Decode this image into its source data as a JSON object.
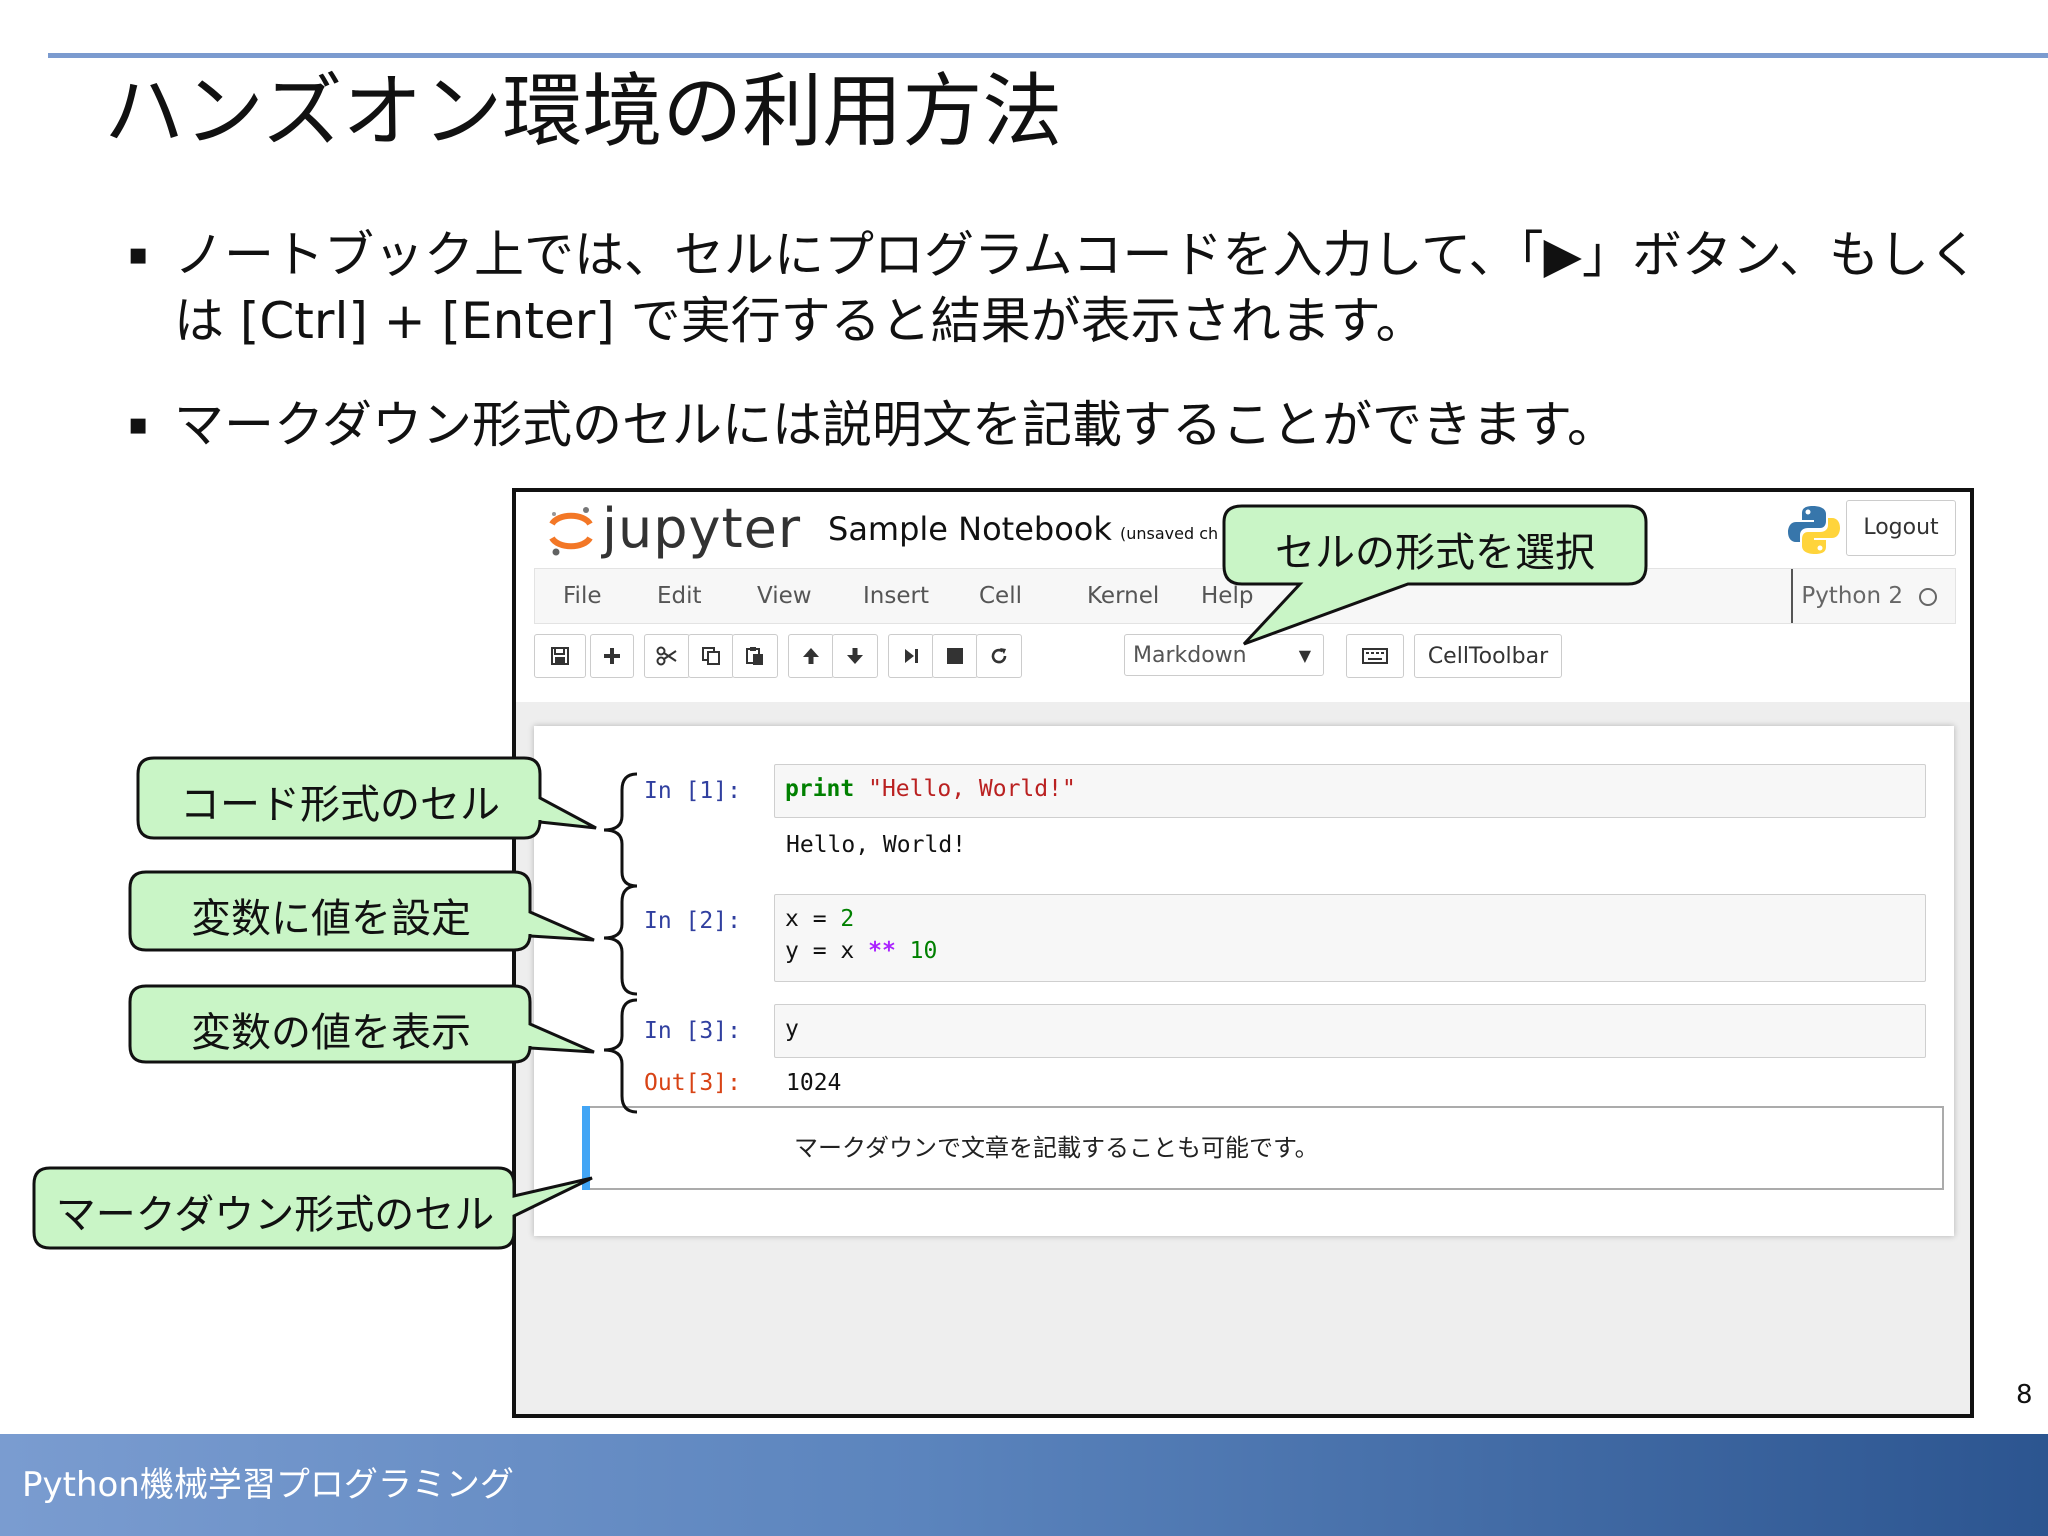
{
  "slide": {
    "title": "ハンズオン環境の利用方法",
    "bullets": [
      "ノートブック上では、セルにプログラムコードを入力して、「▶」ボタン、もしくは [Ctrl] + [Enter] で実行すると結果が表示されます。",
      "マークダウン形式のセルには説明文を記載することができます。"
    ],
    "bullet_mark": "▪",
    "page_number": "8",
    "footer": "Python機械学習プログラミング"
  },
  "jupyter": {
    "logo_text": "jupyter",
    "notebook_name": "Sample Notebook",
    "unsaved": "(unsaved ch",
    "logout": "Logout",
    "menu": [
      "File",
      "Edit",
      "View",
      "Insert",
      "Cell",
      "Kernel",
      "Help"
    ],
    "kernel": "Python 2",
    "cell_type_select": "Markdown",
    "celltoolbar": "CellToolbar",
    "cells": {
      "c1": {
        "prompt": "In [1]:",
        "output": "Hello, World!"
      },
      "c2": {
        "prompt": "In [2]:"
      },
      "c3": {
        "prompt": "In [3]:",
        "code": "y",
        "out_prompt": "Out[3]:",
        "output": "1024"
      },
      "md": {
        "text": "マークダウンで文章を記載することも可能です。"
      }
    },
    "code_tokens": {
      "print_kw": "print",
      "hello_str": "\"Hello, World!\"",
      "x_assign": "x = ",
      "two": "2",
      "y_assign": "y = x ",
      "pow_op": "**",
      "ten": "10"
    }
  },
  "callouts": {
    "cell_format": "セルの形式を選択",
    "code_cell": "コード形式のセル",
    "set_var": "変数に値を設定",
    "show_var": "変数の値を表示",
    "markdown_cell": "マークダウン形式のセル"
  },
  "colors": {
    "callout_fill": "#c9f5c6",
    "footer_start": "#7a9cd0",
    "footer_end": "#2c5590",
    "accent_rule": "#7b9bcf",
    "selected_cell": "#42a5f5"
  }
}
